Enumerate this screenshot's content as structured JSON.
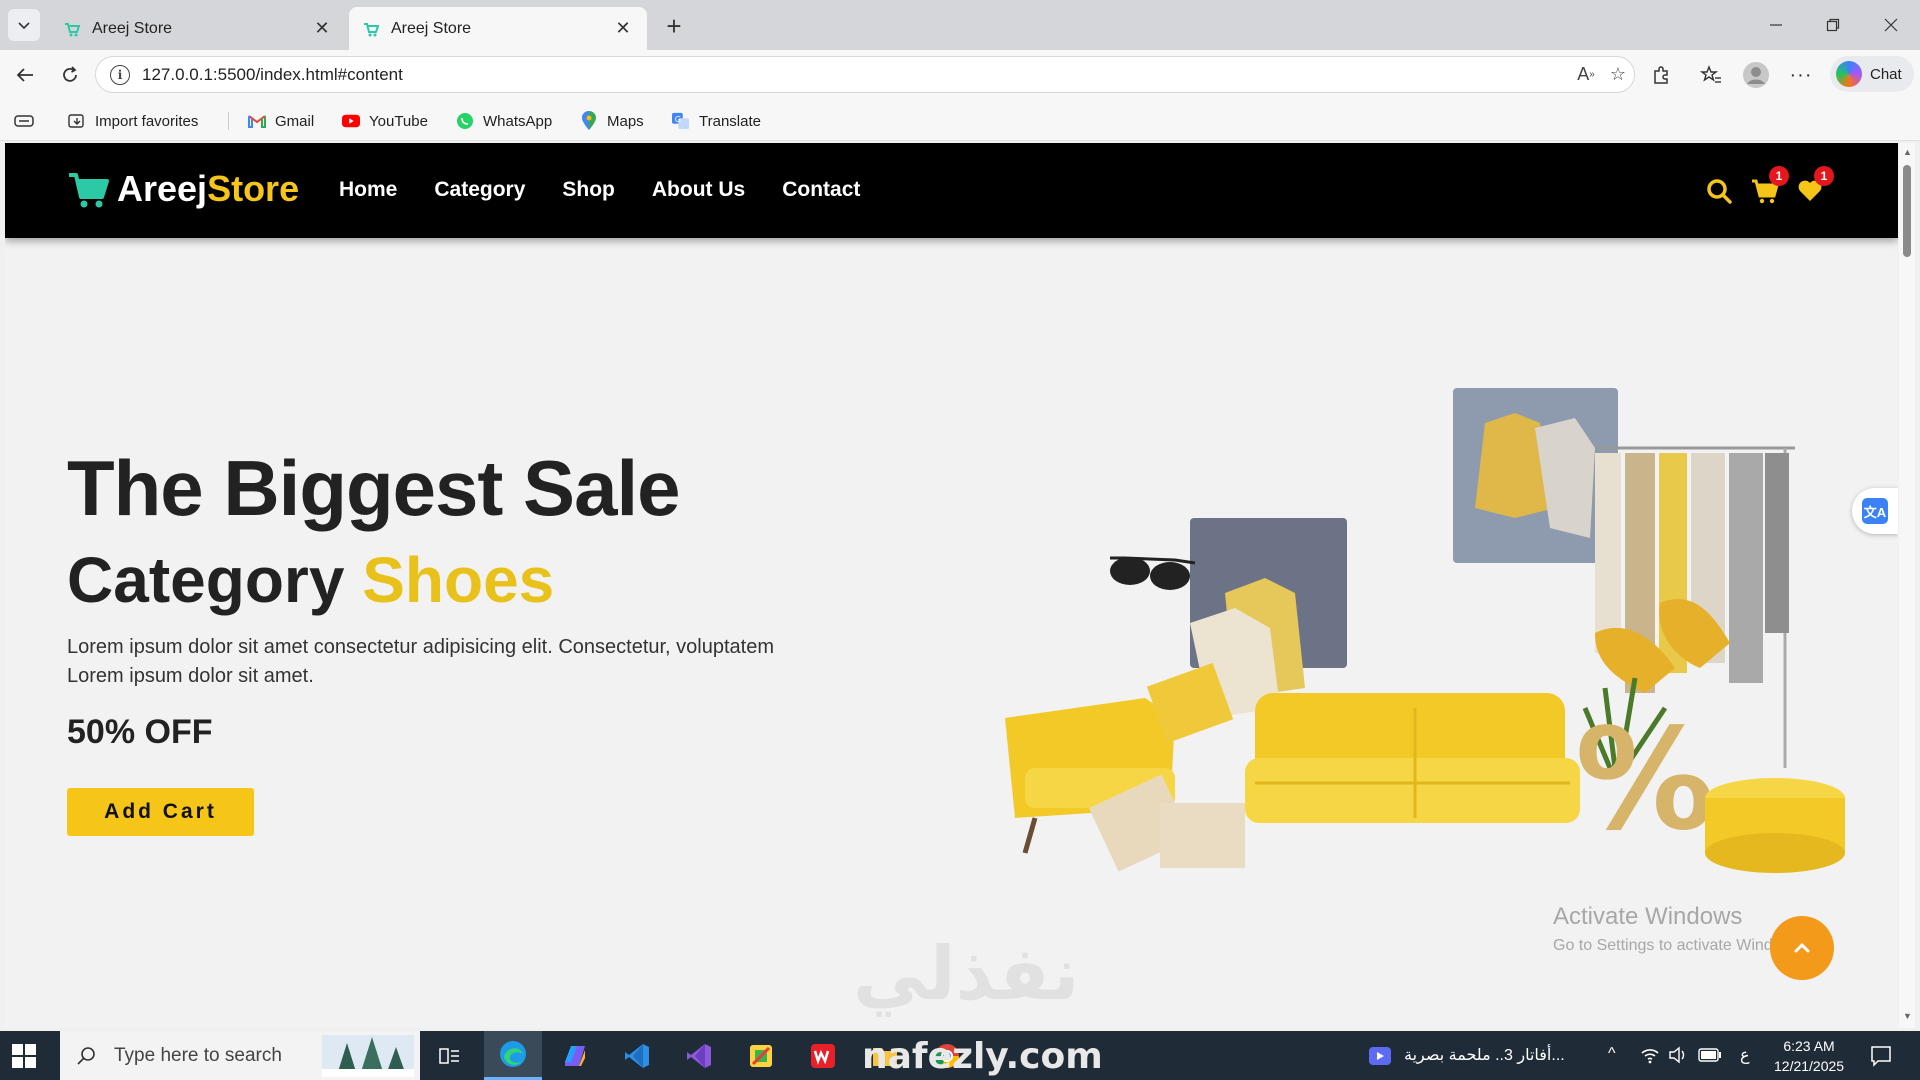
{
  "browser": {
    "tabs": [
      {
        "title": "Areej Store",
        "active": false
      },
      {
        "title": "Areej Store",
        "active": true
      }
    ],
    "address": "127.0.0.1:5500/index.html#content",
    "chat_label": "Chat",
    "bookmarks": [
      {
        "label": "Import favorites",
        "icon": "import-icon"
      },
      {
        "label": "Gmail",
        "icon": "gmail-icon"
      },
      {
        "label": "YouTube",
        "icon": "youtube-icon"
      },
      {
        "label": "WhatsApp",
        "icon": "whatsapp-icon"
      },
      {
        "label": "Maps",
        "icon": "maps-icon"
      },
      {
        "label": "Translate",
        "icon": "translate-icon"
      }
    ]
  },
  "site": {
    "logo_part1": "Areej",
    "logo_part2": "Store",
    "nav": [
      "Home",
      "Category",
      "Shop",
      "About Us",
      "Contact"
    ],
    "cart_count": "1",
    "wishlist_count": "1",
    "accent_color": "#f5c518"
  },
  "hero": {
    "title": "The Biggest Sale",
    "subtitle_prefix": "Category",
    "subtitle_accent": "Shoes",
    "description": "Lorem ipsum dolor sit amet consectetur adipisicing elit. Consectetur, voluptatem Lorem ipsum dolor sit amet.",
    "discount": "50% OFF",
    "button_label": "Add Cart"
  },
  "overlay": {
    "activate_title": "Activate Windows",
    "activate_sub": "Go to Settings to activate Windows.",
    "watermark": "نفذلي"
  },
  "taskbar": {
    "search_placeholder": "Type here to search",
    "media_text": "أفاتار 3.. ملحمة بصرية...",
    "lang": "ع",
    "time": "6:23 AM",
    "date": "12/21/2025",
    "watermark": "nafezly.com"
  }
}
